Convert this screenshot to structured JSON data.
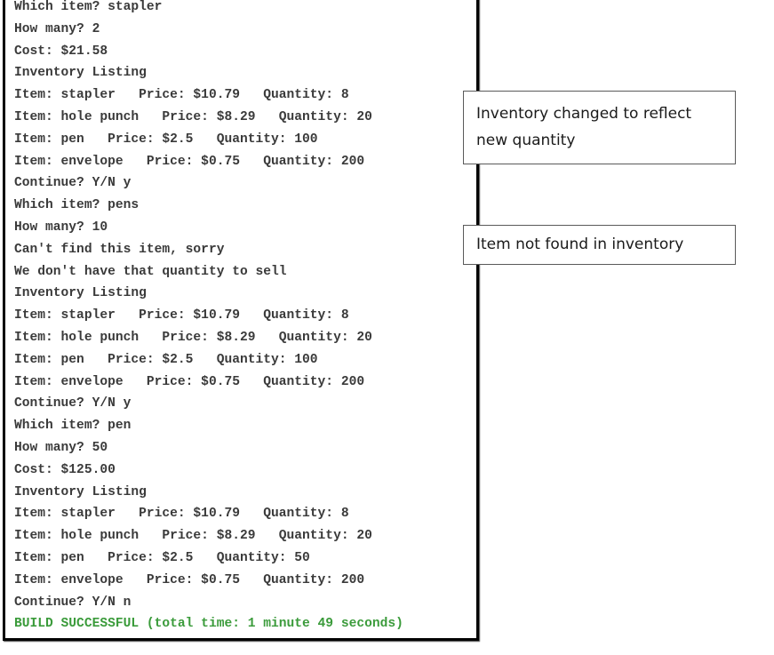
{
  "console": {
    "lines": [
      {
        "text": "Which item? stapler",
        "type": "normal"
      },
      {
        "text": "How many? 2",
        "type": "normal"
      },
      {
        "text": "Cost: $21.58",
        "type": "normal"
      },
      {
        "text": "Inventory Listing",
        "type": "normal"
      },
      {
        "text": "Item: stapler   Price: $10.79   Quantity: 8",
        "type": "normal"
      },
      {
        "text": "Item: hole punch   Price: $8.29   Quantity: 20",
        "type": "normal"
      },
      {
        "text": "Item: pen   Price: $2.5   Quantity: 100",
        "type": "normal"
      },
      {
        "text": "Item: envelope   Price: $0.75   Quantity: 200",
        "type": "normal"
      },
      {
        "text": "Continue? Y/N y",
        "type": "normal"
      },
      {
        "text": "Which item? pens",
        "type": "normal"
      },
      {
        "text": "How many? 10",
        "type": "normal"
      },
      {
        "text": "Can't find this item, sorry",
        "type": "normal"
      },
      {
        "text": "We don't have that quantity to sell",
        "type": "normal"
      },
      {
        "text": "Inventory Listing",
        "type": "normal"
      },
      {
        "text": "Item: stapler   Price: $10.79   Quantity: 8",
        "type": "normal"
      },
      {
        "text": "Item: hole punch   Price: $8.29   Quantity: 20",
        "type": "normal"
      },
      {
        "text": "Item: pen   Price: $2.5   Quantity: 100",
        "type": "normal"
      },
      {
        "text": "Item: envelope   Price: $0.75   Quantity: 200",
        "type": "normal"
      },
      {
        "text": "Continue? Y/N y",
        "type": "normal"
      },
      {
        "text": "Which item? pen",
        "type": "normal"
      },
      {
        "text": "How many? 50",
        "type": "normal"
      },
      {
        "text": "Cost: $125.00",
        "type": "normal"
      },
      {
        "text": "Inventory Listing",
        "type": "normal"
      },
      {
        "text": "Item: stapler   Price: $10.79   Quantity: 8",
        "type": "normal"
      },
      {
        "text": "Item: hole punch   Price: $8.29   Quantity: 20",
        "type": "normal"
      },
      {
        "text": "Item: pen   Price: $2.5   Quantity: 50",
        "type": "normal"
      },
      {
        "text": "Item: envelope   Price: $0.75   Quantity: 200",
        "type": "normal"
      },
      {
        "text": "Continue? Y/N n",
        "type": "normal"
      },
      {
        "text": "BUILD SUCCESSFUL (total time: 1 minute 49 seconds)",
        "type": "success"
      }
    ]
  },
  "callouts": {
    "inventory_changed": {
      "line1": "Inventory changed to reflect",
      "line2": "new quantity"
    },
    "item_not_found": {
      "text": "Item not found in inventory"
    }
  },
  "colors": {
    "console_text": "#3a3a3a",
    "build_success": "#3b9b3b",
    "frame_border": "#000000"
  }
}
